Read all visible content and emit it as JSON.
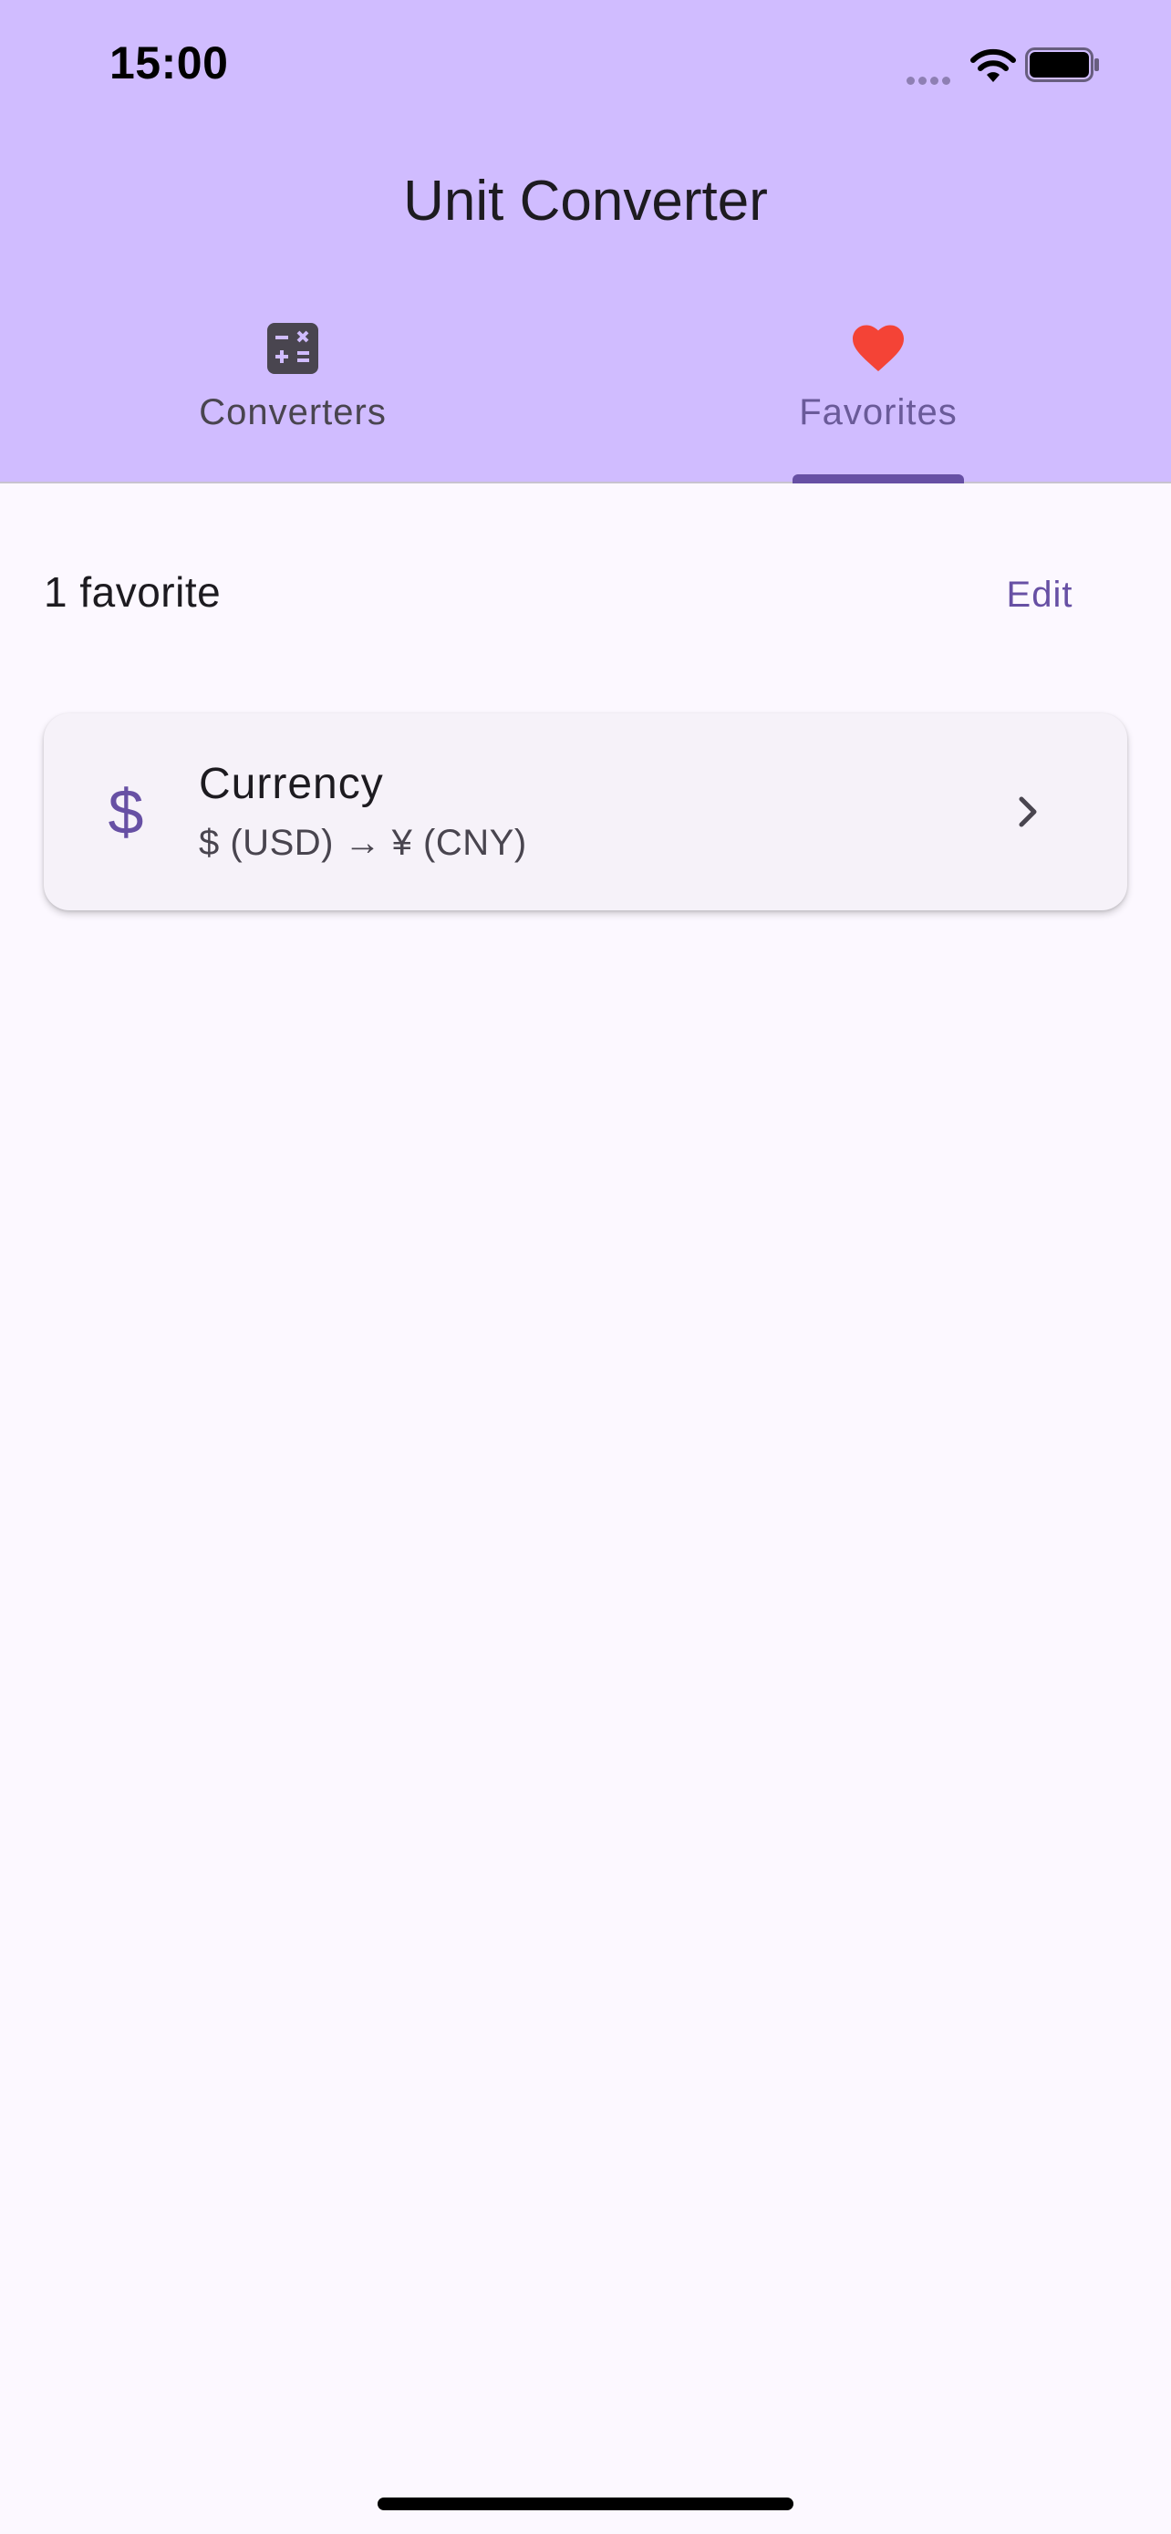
{
  "status_bar": {
    "time": "15:00",
    "icons": [
      "signal-dots-icon",
      "wifi-icon",
      "battery-icon"
    ]
  },
  "app_bar": {
    "title": "Unit Converter"
  },
  "tabs": [
    {
      "label": "Converters",
      "icon": "calculator-icon",
      "selected": false
    },
    {
      "label": "Favorites",
      "icon": "heart-icon",
      "selected": true
    }
  ],
  "favorites": {
    "count_label": "1 favorite",
    "edit_label": "Edit",
    "items": [
      {
        "icon": "dollar-icon",
        "icon_glyph": "$",
        "title": "Currency",
        "subtitle": "$ (USD) → ¥ (CNY)"
      }
    ]
  },
  "colors": {
    "header_bg": "#d0bcff",
    "page_bg": "#fcf8ff",
    "accent": "#6750a4",
    "heart": "#f44336",
    "card_bg": "#f6f2f9"
  }
}
